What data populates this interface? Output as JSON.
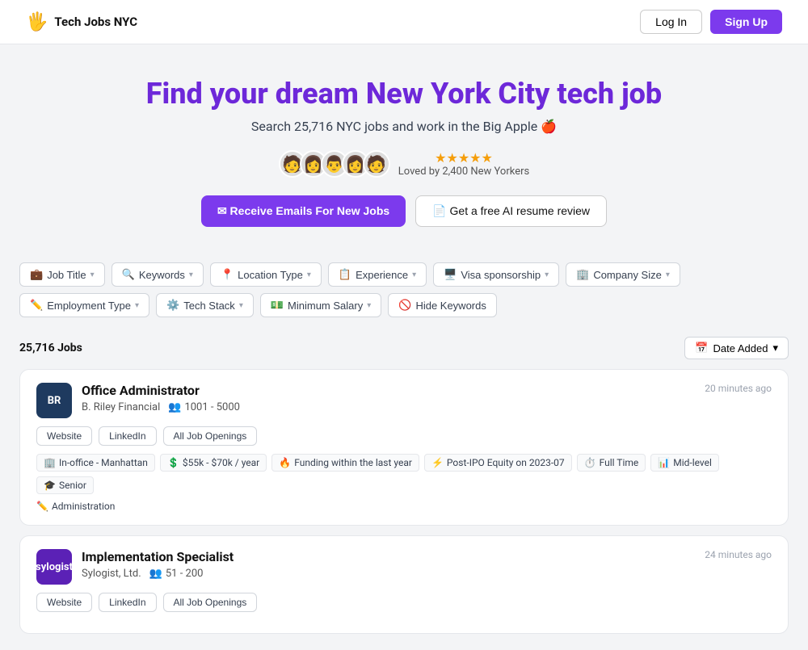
{
  "header": {
    "logo_icon": "🖐️",
    "logo_text": "Tech Jobs NYC",
    "login_label": "Log In",
    "signup_label": "Sign Up"
  },
  "hero": {
    "title": "Find your dream New York City tech job",
    "subtitle": "Search 25,716 NYC jobs and work in the Big Apple 🍎",
    "loved_text": "Loved by 2,400 New Yorkers",
    "stars": "★★★★★",
    "cta_email": "✉ Receive Emails For New Jobs",
    "cta_resume": "📄 Get a free AI resume review",
    "avatars": [
      "🧑",
      "👩",
      "👨",
      "👩",
      "🧑"
    ]
  },
  "filters": {
    "row1": [
      {
        "icon": "💼",
        "label": "Job Title",
        "arrow": "▾"
      },
      {
        "icon": "🔍",
        "label": "Keywords",
        "arrow": "▾"
      },
      {
        "icon": "📍",
        "label": "Location Type",
        "arrow": "▾"
      },
      {
        "icon": "📋",
        "label": "Experience",
        "arrow": "▾"
      },
      {
        "icon": "🖥️",
        "label": "Visa sponsorship",
        "arrow": "▾"
      },
      {
        "icon": "🏢",
        "label": "Company Size",
        "arrow": "▾"
      }
    ],
    "row2": [
      {
        "icon": "✏️",
        "label": "Employment Type",
        "arrow": "▾"
      },
      {
        "icon": "⚙️",
        "label": "Tech Stack",
        "arrow": "▾"
      },
      {
        "icon": "💵",
        "label": "Minimum Salary",
        "arrow": "▾"
      },
      {
        "icon": "🚫",
        "label": "Hide Keywords",
        "arrow": ""
      }
    ]
  },
  "results": {
    "count_label": "25,716 Jobs",
    "sort_label": "Date Added",
    "sort_icon": "📅",
    "jobs": [
      {
        "id": "job-1",
        "company_logo_text": "BR",
        "company_logo_bg": "#1e3a5f",
        "title": "Office Administrator",
        "company": "B. Riley Financial",
        "size_icon": "👥",
        "size": "1001 - 5000",
        "time_ago": "20 minutes ago",
        "links": [
          "Website",
          "LinkedIn",
          "All Job Openings"
        ],
        "tags": [
          {
            "icon": "🏢",
            "text": "In-office - Manhattan"
          },
          {
            "icon": "💲",
            "text": "$55k - $70k / year"
          },
          {
            "icon": "🔥",
            "text": "Funding within the last year"
          },
          {
            "icon": "⚡",
            "text": "Post-IPO Equity on 2023-07"
          },
          {
            "icon": "⏱️",
            "text": "Full Time"
          },
          {
            "icon": "📊",
            "text": "Mid-level"
          },
          {
            "icon": "🎓",
            "text": "Senior"
          }
        ],
        "categories": [
          {
            "icon": "✏️",
            "text": "Administration"
          }
        ]
      },
      {
        "id": "job-2",
        "company_logo_text": "sylogist",
        "company_logo_bg": "#5b21b6",
        "title": "Implementation Specialist",
        "company": "Sylogist, Ltd.",
        "size_icon": "👥",
        "size": "51 - 200",
        "time_ago": "24 minutes ago",
        "links": [
          "Website",
          "LinkedIn",
          "All Job Openings"
        ],
        "tags": [],
        "categories": []
      }
    ]
  }
}
